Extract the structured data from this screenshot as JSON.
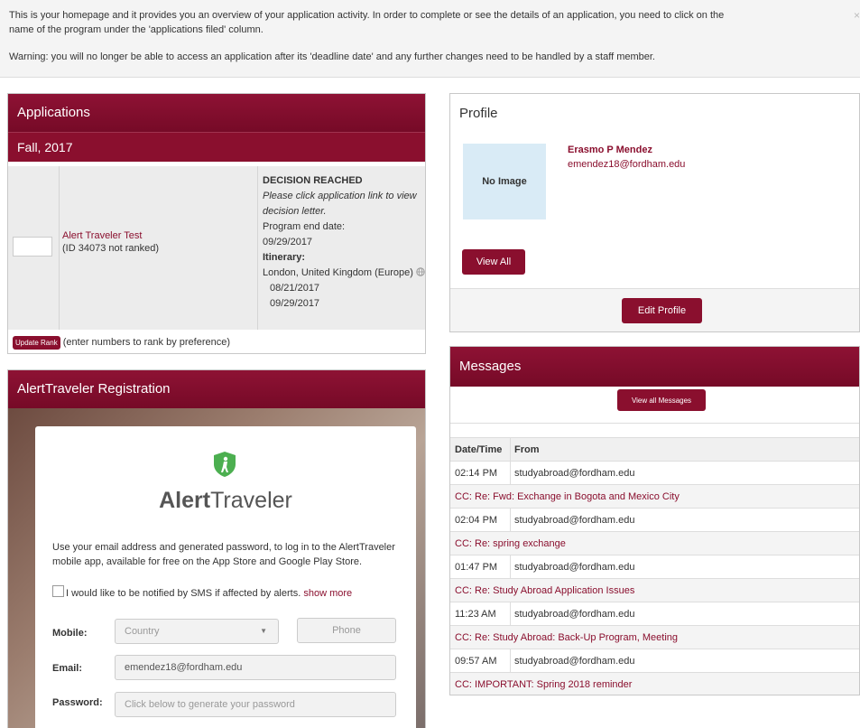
{
  "notice": {
    "line1": "This is your homepage and it provides you an overview of your application activity. In order to complete or see the details of an application, you need to click on the",
    "line1b": "name of the program under the 'applications filed' column.",
    "warning": "Warning: you will no longer be able to access an application after its 'deadline date' and any further changes need to be handled by a staff member.",
    "close": "×"
  },
  "applications": {
    "title": "Applications",
    "term": "Fall, 2017",
    "app_name": "Alert Traveler Test",
    "app_id": "(ID 34073 not ranked)",
    "status": "DECISION REACHED",
    "status_note": "Please click application link to view decision letter.",
    "end_label": "Program end date:",
    "end_date": "09/29/2017",
    "itinerary_label": "Itinerary:",
    "itinerary_place": "London, United Kingdom (Europe)",
    "date_start": "08/21/2017",
    "date_end": "09/29/2017",
    "update_btn": "Update Rank",
    "update_hint": "(enter numbers to rank by preference)"
  },
  "alert": {
    "title": "AlertTraveler Registration",
    "brand_bold": "Alert",
    "brand_light": "Traveler",
    "desc": "Use your email address and generated password, to log in to the AlertTraveler mobile app, available for free on the App Store and Google Play Store.",
    "sms": "I would like to be notified by SMS if affected by alerts.",
    "show_more": "show more",
    "mobile_label": "Mobile:",
    "country": "Country",
    "phone": "Phone",
    "email_label": "Email:",
    "email": "emendez18@fordham.edu",
    "password_label": "Password:",
    "password": "Click below to generate your password"
  },
  "profile": {
    "title": "Profile",
    "no_image": "No Image",
    "name": "Erasmo P Mendez",
    "email": "emendez18@fordham.edu",
    "view_all": "View All",
    "edit": "Edit Profile"
  },
  "messages": {
    "title": "Messages",
    "view_all": "View all Messages",
    "col_time": "Date/Time",
    "col_from": "From",
    "rows": [
      {
        "time": "02:14 PM",
        "from": "studyabroad@fordham.edu",
        "subject": "CC: Re: Fwd: Exchange in Bogota and Mexico City"
      },
      {
        "time": "02:04 PM",
        "from": "studyabroad@fordham.edu",
        "subject": "CC: Re: spring exchange"
      },
      {
        "time": "01:47 PM",
        "from": "studyabroad@fordham.edu",
        "subject": "CC: Re: Study Abroad Application Issues"
      },
      {
        "time": "11:23 AM",
        "from": "studyabroad@fordham.edu",
        "subject": "CC: Re: Study Abroad: Back-Up Program, Meeting"
      },
      {
        "time": "09:57 AM",
        "from": "studyabroad@fordham.edu",
        "subject": "CC: IMPORTANT: Spring 2018 reminder"
      }
    ]
  }
}
